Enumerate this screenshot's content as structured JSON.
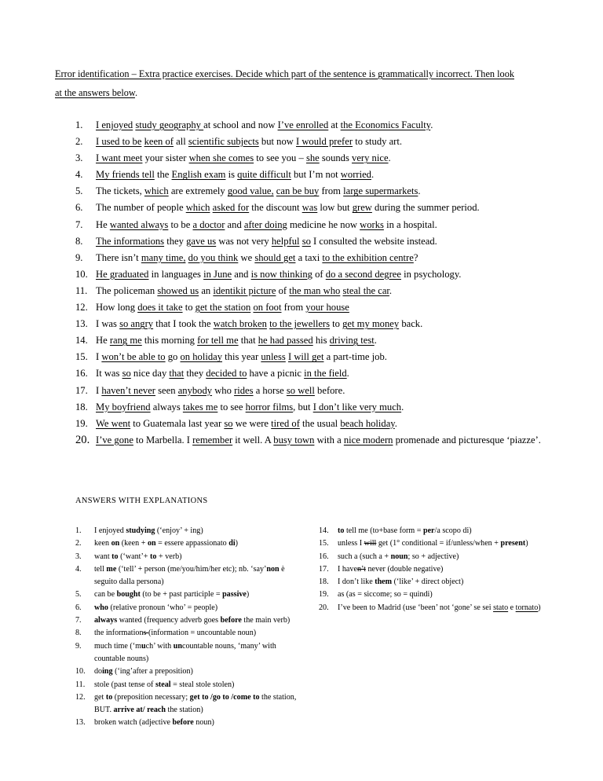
{
  "document": {
    "intro": {
      "line1": "Error identification – Extra practice exercises.  Decide which part of the sentence is grammatically incorrect. Then look",
      "line2": "at the answers below",
      "line2_tail": "."
    },
    "exercises": [
      {
        "num": "1.",
        "html": "<u>I enjoyed</u>  <u>study geography </u>at school and now <u>I’ve enrolled</u> at <u>the Economics Faculty</u>."
      },
      {
        "num": "2.",
        "html": "<u>I used to be</u>  <u>keen of</u> all <u>scientific subjects</u> but now <u>I would prefer</u> to study art."
      },
      {
        "num": "3.",
        "html": "<u>I want meet</u> your sister <u>when she comes</u> to see you – <u>she</u> sounds <u>very nice</u>."
      },
      {
        "num": "4.",
        "html": "<u>My friends tell</u> the <u>English exam</u> is <u>quite difficult</u> but I’m not <u>worried</u>."
      },
      {
        "num": "5.",
        "html": "The tickets, <u>which</u> are extremely <u>good value,</u> <u>can be buy</u> from <u>large supermarkets</u>."
      },
      {
        "num": "6.",
        "html": "The number of people <u>which</u> <u>asked for</u> the discount <u>was</u> low but <u>grew</u> during the summer period."
      },
      {
        "num": "7.",
        "html": "He <u>wanted always</u> to be <u>a doctor</u> and <u>after doing</u> medicine he now <u>works</u> in a hospital."
      },
      {
        "num": "8.",
        "html": "<u>The informations</u> they <u>gave us</u> was not very <u>helpful</u> <u>so</u> I consulted the website instead."
      },
      {
        "num": "9.",
        "html": "There isn’t <u>many time,</u> <u>do you think</u> we <u>should get</u> a taxi <u>to the exhibition centre</u>?"
      },
      {
        "num": "10.",
        "html": "<u>He graduated</u> in languages <u>in June</u> and <u>is now thinking</u> of <u>do a second degree</u> in psychology."
      },
      {
        "num": "11.",
        "html": "The policeman <u>showed us</u> an <u>identikit picture</u> of <u>the man who</u> <u>steal the car</u>."
      },
      {
        "num": "12.",
        "html": "How long <u>does it take</u> to <u>get the station</u> <u>on foot</u> from <u>your house</u>"
      },
      {
        "num": "13.",
        "html": "I was <u>so angry</u> that I took the <u>watch broken</u> <u>to the jewellers</u> to <u>get my money</u> back."
      },
      {
        "num": "14.",
        "html": "He <u>rang me</u> this morning <u>for tell me</u> that <u>he had passed</u> his <u>driving test</u>."
      },
      {
        "num": "15.",
        "html": "I <u>won’t be able to</u> go <u>on holiday</u> this year <u>unless</u> <u>I will get</u> a part-time job."
      },
      {
        "num": "16.",
        "html": "It was <u>so</u> nice day <u>that</u> they <u>decided to</u> have a picnic <u>in the field</u>."
      },
      {
        "num": "17.",
        "html": "I <u>haven’t never</u> seen <u>anybody</u> who <u>rides</u> a horse <u>so well</u> before."
      },
      {
        "num": "18.",
        "html": "<u>My boyfriend</u> always <u>takes me</u> to see <u>horror films</u>, but <u>I don’t like very much</u>."
      },
      {
        "num": "19.",
        "html": "<u>We went</u> to Guatemala last year <u>so</u> we were <u>tired of</u> the usual <u>beach holiday</u>."
      },
      {
        "num": "20.",
        "html": "<u>I’ve gone</u> to Marbella. I <u>remember</u> it well. A <u>busy town</u> with a <u>nice modern</u> promenade and picturesque ‘piazze’.",
        "large_num": true
      }
    ],
    "answers_heading": "ANSWERS WITH EXPLANATIONS",
    "answers_left": [
      {
        "num": "1.",
        "html": "I enjoyed <b>studying</b> (‘enjoy’  + ing)"
      },
      {
        "num": "2.",
        "html": "keen <b>on</b> (keen + <b>on</b> = essere appassionato <b>di</b>)"
      },
      {
        "num": "3.",
        "html": "want <b>to</b> (‘want’+ <b>to</b> + verb)"
      },
      {
        "num": "4.",
        "html": "tell <b>me</b> (‘tell’ + person (me/you/him/her etc); nb. ‘say’<b>non</b> è seguito dalla persona)"
      },
      {
        "num": "5.",
        "html": "can be <b>bought</b> (to be + past participle = <b>passive</b>)"
      },
      {
        "num": "6.",
        "html": "<b>who</b> (relative pronoun ‘who’ = people)"
      },
      {
        "num": "7.",
        "html": "<b>always</b> wanted (frequency adverb goes <b>before</b> the main verb)"
      },
      {
        "num": "8.",
        "html": "the information<s>s </s>(information = uncountable noun)"
      },
      {
        "num": "9.",
        "html": "much time (‘m<b>u</b>ch’ with <b>un</b>countable nouns, ‘many’ with countable nouns)"
      },
      {
        "num": "10.",
        "html": "do<b>ing</b> (‘ing’after a preposition)"
      },
      {
        "num": "11.",
        "html": "stole (past tense of <b>steal</b> = steal stole stolen)"
      },
      {
        "num": "12.",
        "html": "get <b>to</b> (preposition necessary; <b>get to /go to /come to</b> the station, BUT. <b>arrive at/ reach</b> the station)"
      },
      {
        "num": "13.",
        "html": "broken watch (adjective <b>before</b> noun)"
      }
    ],
    "answers_right": [
      {
        "num": "14.",
        "html": "<b>to</b> tell me (to+base form = <b>per</b>/a scopo di)"
      },
      {
        "num": "15.",
        "html": "unless I <s>will</s> get (1° conditional = if/unless/when + <b>present</b>)"
      },
      {
        "num": "16.",
        "html": "such a (such a + <b>noun</b>; so + adjective)"
      },
      {
        "num": "17.",
        "html": "I have<s>n’t</s> never (double negative)"
      },
      {
        "num": "18.",
        "html": "I don’t like <b>them</b> (‘like’ + direct object)"
      },
      {
        "num": "19.",
        "html": "as (as = siccome; so = quindi)"
      },
      {
        "num": "20.",
        "html": "I’ve been to Madrid (use ‘been’ not ‘gone’ se sei <u>stato</u> e <u>tornato</u>)"
      }
    ]
  }
}
